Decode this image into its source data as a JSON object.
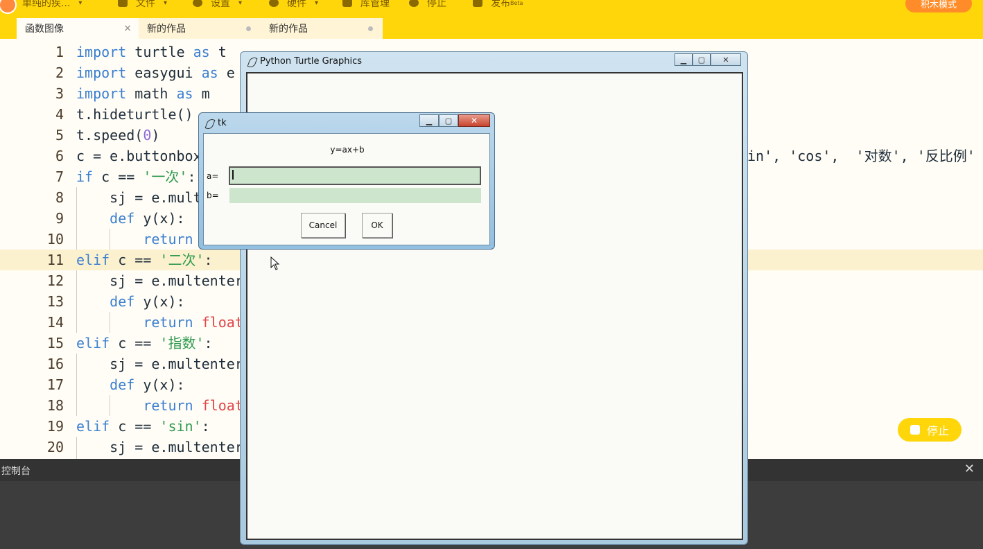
{
  "toolbar": {
    "project_name": "单纯的疾...",
    "file_label": "文件",
    "settings_label": "设置",
    "hardware_label": "硬件",
    "library_label": "库管理",
    "stop_label": "停止",
    "publish_label": "发布",
    "publish_badge": "Beta",
    "mode_label": "积木模式"
  },
  "tabs": [
    {
      "label": "函数图像",
      "active": true
    },
    {
      "label": "新的作品",
      "active": false
    },
    {
      "label": "新的作品",
      "active": false
    }
  ],
  "editor": {
    "line_numbers": [
      "1",
      "2",
      "3",
      "4",
      "5",
      "6",
      "7",
      "8",
      "9",
      "10",
      "11",
      "12",
      "13",
      "14",
      "15",
      "16",
      "17",
      "18",
      "19",
      "20"
    ],
    "highlight_line": "11",
    "line6_tail": "in', 'cos',  '对数', '反比例'"
  },
  "stop_float_label": "停止",
  "console": {
    "title": "控制台",
    "close": "✕"
  },
  "turtle_window": {
    "title": "Python Turtle Graphics"
  },
  "tk_dialog": {
    "title": "tk",
    "caption": "y=ax+b",
    "label_a": "a=",
    "label_b": "b=",
    "cancel_label": "Cancel",
    "ok_label": "OK"
  },
  "colors": {
    "accent": "#ffd60a",
    "mode_button": "#ff8c29",
    "keyword": "#3b7fd1",
    "string": "#2f9a4f"
  }
}
